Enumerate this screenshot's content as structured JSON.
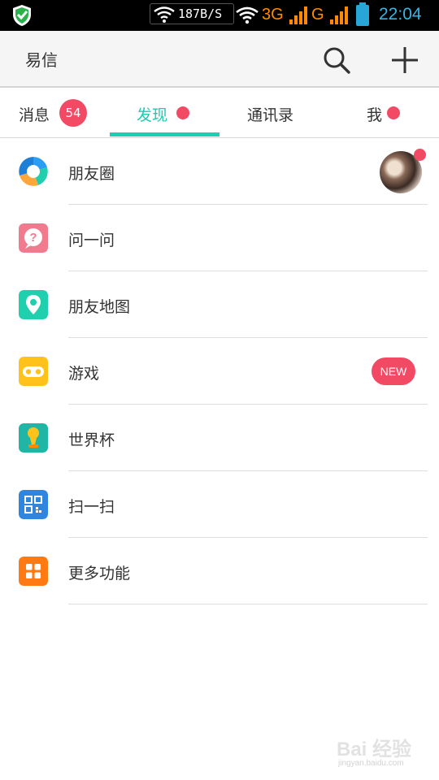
{
  "status_bar": {
    "net_speed": "187B/S",
    "network_3g": "3G",
    "network_g": "G",
    "time": "22:04",
    "icons": [
      "shield-icon",
      "wifi-icon",
      "signal-icon",
      "battery-icon"
    ]
  },
  "header": {
    "title": "易信",
    "search_icon": "search-icon",
    "add_icon": "plus-icon"
  },
  "tabs": [
    {
      "label": "消息",
      "badge": "54",
      "active": false
    },
    {
      "label": "发现",
      "dot": true,
      "active": true
    },
    {
      "label": "通讯录",
      "active": false
    },
    {
      "label": "我",
      "dot": true,
      "active": false
    }
  ],
  "list": [
    {
      "label": "朋友圈",
      "icon": "moments-icon",
      "color": "#2a9df4"
    },
    {
      "label": "问一问",
      "icon": "question-icon",
      "color": "#f27a8e"
    },
    {
      "label": "朋友地图",
      "icon": "map-pin-icon",
      "color": "#1fcfae"
    },
    {
      "label": "游戏",
      "icon": "game-icon",
      "color": "#ffc21a",
      "badge": "NEW"
    },
    {
      "label": "世界杯",
      "icon": "trophy-icon",
      "color": "#1fb6a6"
    },
    {
      "label": "扫一扫",
      "icon": "qr-scan-icon",
      "color": "#2e86e0"
    },
    {
      "label": "更多功能",
      "icon": "grid-icon",
      "color": "#ff7a12"
    }
  ],
  "watermark": {
    "text": "Bai 经验",
    "url": "jingyan.baidu.com"
  },
  "colors": {
    "accent": "#1ccfb3",
    "badge": "#f24a64",
    "status_time": "#33b5e5"
  }
}
